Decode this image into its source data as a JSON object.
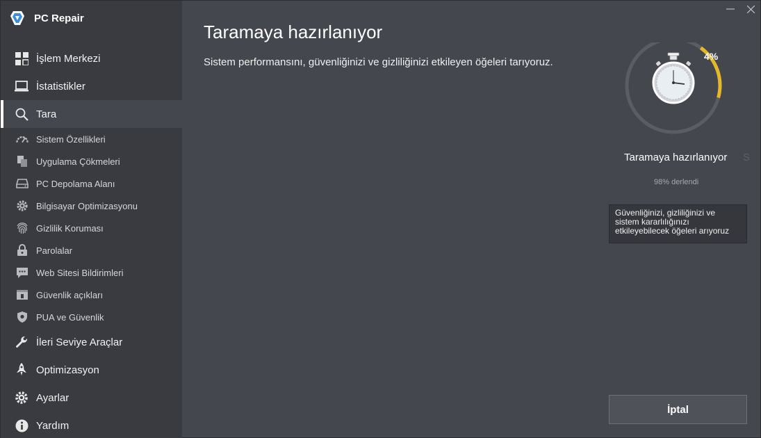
{
  "app": {
    "name": "PC Repair"
  },
  "sidebar": {
    "top_items": [
      {
        "label": "İşlem Merkezi",
        "icon": "grid-icon"
      },
      {
        "label": "İstatistikler",
        "icon": "laptop-icon"
      },
      {
        "label": "Tara",
        "icon": "search-icon",
        "active": true
      }
    ],
    "sub_items": [
      {
        "label": "Sistem Özellikleri",
        "icon": "speedometer-icon"
      },
      {
        "label": "Uygulama Çökmeleri",
        "icon": "documents-icon"
      },
      {
        "label": "PC Depolama Alanı",
        "icon": "hard-drive-icon"
      },
      {
        "label": "Bilgisayar Optimizasyonu",
        "icon": "gear-icon"
      },
      {
        "label": "Gizlilik Koruması",
        "icon": "fingerprint-icon"
      },
      {
        "label": "Parolalar",
        "icon": "lock-icon"
      },
      {
        "label": "Web Sitesi Bildirimleri",
        "icon": "chat-icon"
      },
      {
        "label": "Güvenlik açıkları",
        "icon": "vulnerability-icon"
      },
      {
        "label": "PUA ve Güvenlik",
        "icon": "shield-icon"
      }
    ],
    "bottom_items": [
      {
        "label": "İleri Seviye Araçlar",
        "icon": "wrench-icon"
      },
      {
        "label": "Optimizasyon",
        "icon": "rocket-icon"
      },
      {
        "label": "Ayarlar",
        "icon": "gear-icon"
      },
      {
        "label": "Yardım",
        "icon": "info-icon"
      }
    ]
  },
  "main": {
    "title": "Taramaya hazırlanıyor",
    "description": "Sistem performansını, güvenliğinizi ve gizliliğinizi etkileyen öğeleri tarıyoruz.",
    "progress_percent": 4,
    "progress_label": "4%",
    "status_text": "Taramaya hazırlanıyor",
    "status_ghost": "S",
    "compiled_text": "98% derlendi",
    "tooltip_text": "Güvenliğinizi, gizliliğinizi ve sistem kararlılığınızı etkileyebilecek öğeleri arıyoruz",
    "cancel_label": "İptal"
  },
  "colors": {
    "sidebar_bg": "#393b41",
    "main_bg": "#45474e",
    "progress_track": "#5b5d63",
    "progress_fill": "#e5b82a"
  }
}
